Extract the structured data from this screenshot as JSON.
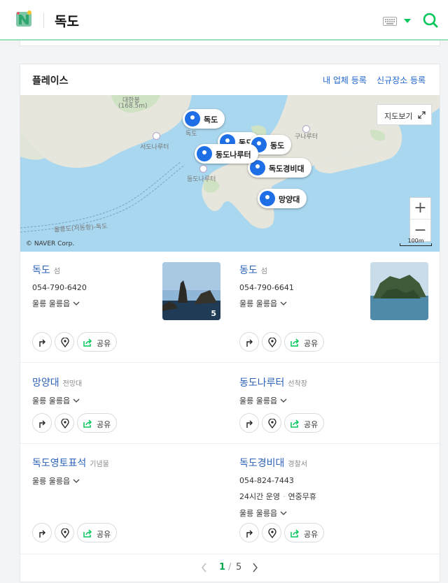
{
  "header": {
    "query": "독도",
    "icons": {
      "logo": "naver-logo",
      "keyboard": "keyboard-icon",
      "caret": "caret-down-icon",
      "search": "search-icon"
    },
    "colors": {
      "accent": "#03c75a",
      "underline": "#9be0bd"
    }
  },
  "places": {
    "title": "플레이스",
    "register_business": "내 업체 등록",
    "register_new_place": "신규장소 등록",
    "map": {
      "view_button": "지도보기",
      "copyright": "© NAVER Corp.",
      "scale": "100m",
      "zoom_in": "+",
      "zoom_out": "−",
      "labels": {
        "peak": "대한봉",
        "peak_height": "(168.5m)",
        "seodo_dock": "서도나루터",
        "dokdo": "독도",
        "dongdo_dock": "동도나루터",
        "gunaru": "구나루터",
        "ferry_route": "울릉도(저동항)-독도"
      },
      "pins": [
        "독도",
        "동도",
        "동도",
        "동도나루터",
        "독도경비대",
        "망양대"
      ]
    },
    "items": [
      {
        "name": "독도",
        "category": "섬",
        "phone": "054-790-6420",
        "address": "울릉 울릉읍",
        "photo_count": "5"
      },
      {
        "name": "동도",
        "category": "섬",
        "phone": "054-790-6641",
        "address": "울릉 울릉읍"
      },
      {
        "name": "망양대",
        "category": "전망대",
        "address": "울릉 울릉읍"
      },
      {
        "name": "동도나루터",
        "category": "선착장",
        "address": "울릉 울릉읍"
      },
      {
        "name": "독도영토표석",
        "category": "기념물",
        "address": "울릉 울릉읍"
      },
      {
        "name": "독도경비대",
        "category": "경찰서",
        "phone": "054-824-7443",
        "hours": "24시간 운영",
        "holiday": "연중무휴",
        "address": "울릉 울릉읍"
      }
    ],
    "actions": {
      "share": "공유",
      "icons": [
        "directions-icon",
        "pin-icon",
        "share-icon"
      ]
    },
    "pager": {
      "current": "1",
      "separator": "/",
      "total": "5"
    }
  }
}
